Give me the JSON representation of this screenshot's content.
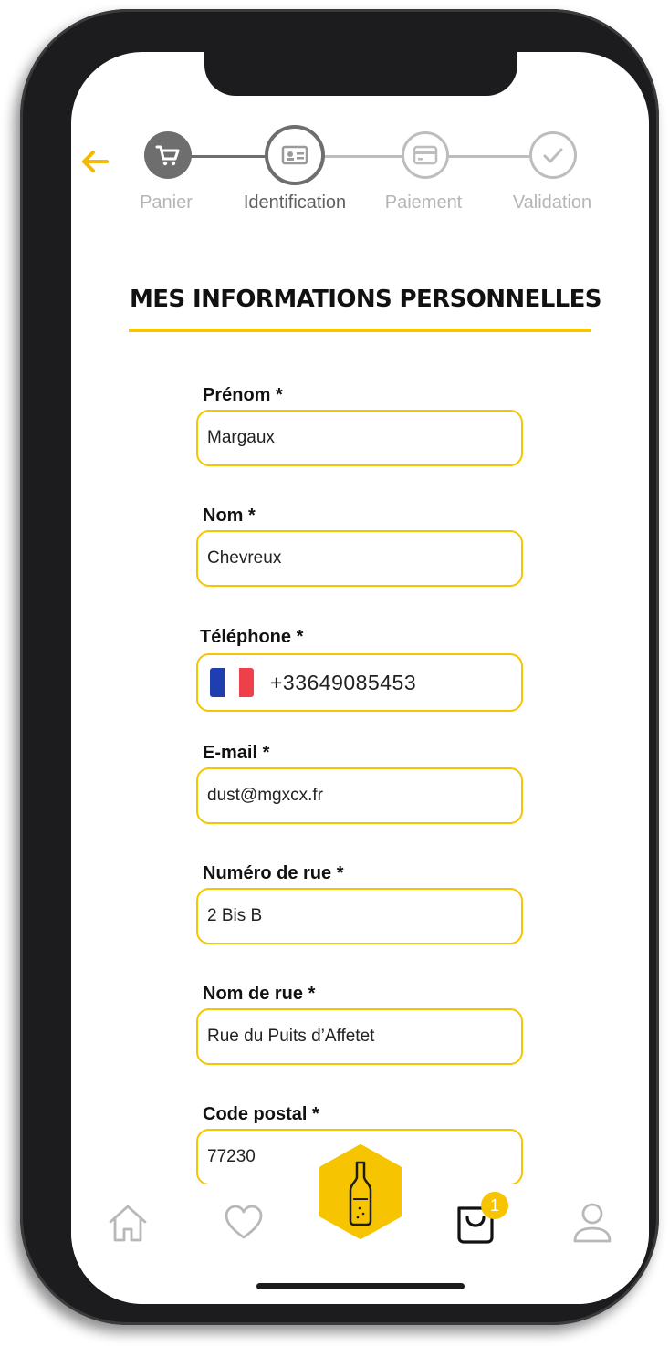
{
  "stepper": {
    "steps": [
      {
        "label": "Panier",
        "icon": "cart-icon",
        "state": "done"
      },
      {
        "label": "Identification",
        "icon": "id-card-icon",
        "state": "current"
      },
      {
        "label": "Paiement",
        "icon": "credit-card-icon",
        "state": "todo"
      },
      {
        "label": "Validation",
        "icon": "check-circle-icon",
        "state": "todo"
      }
    ]
  },
  "back_icon": "arrow-left-icon",
  "section": {
    "title": "MES INFORMATIONS PERSONNELLES"
  },
  "form": {
    "first_name": {
      "label": "Prénom *",
      "value": "Margaux"
    },
    "last_name": {
      "label": "Nom *",
      "value": "Chevreux"
    },
    "phone": {
      "label": "Téléphone *",
      "value": "+33649085453",
      "country_flag": "france-flag-icon"
    },
    "email": {
      "label": "E-mail *",
      "value": "dust@mgxcx.fr"
    },
    "street_number": {
      "label": "Numéro de rue *",
      "value": "2 Bis B"
    },
    "street_name": {
      "label": "Nom de rue *",
      "value": "Rue du Puits d’Affetet"
    },
    "postal_code": {
      "label": "Code postal *",
      "value": "77230"
    }
  },
  "tabbar": {
    "items": [
      "home-icon",
      "heart-icon",
      "bottle-icon",
      "bag-icon",
      "user-icon"
    ],
    "cart_badge": "1"
  },
  "colors": {
    "accent": "#f6c400",
    "step_done": "#6e6e6e",
    "step_todo": "#bdbdbd"
  }
}
